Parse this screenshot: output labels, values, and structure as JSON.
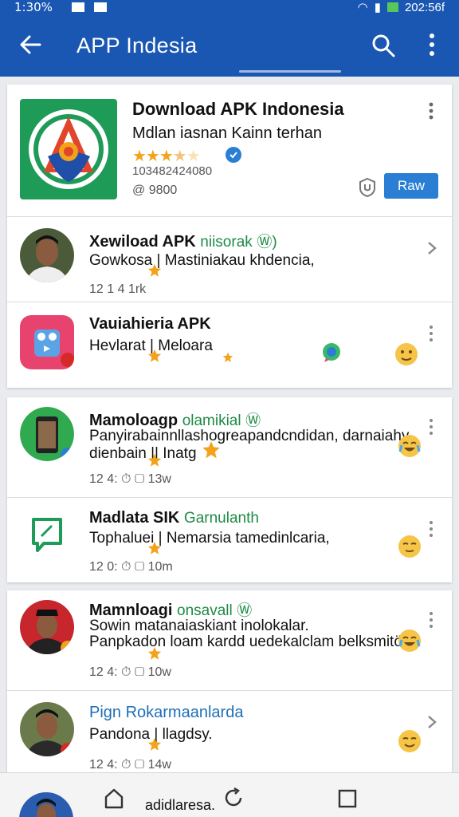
{
  "status_bar": {
    "time": "1:30%",
    "right_text": "202:56f"
  },
  "app_bar": {
    "title": "APP Indesia"
  },
  "featured": {
    "title": "Download APK Indonesia",
    "subtitle": "Mdlan iasnan Kainn terhan",
    "rating_stars": 3.5,
    "meta1": "103482424080",
    "meta2": "@ 9800",
    "action_label": "Raw"
  },
  "list1": [
    {
      "name": "Xewiload APK",
      "tag": "niisorak",
      "desc": "Gowkosa | Mastiniakau khdencia,",
      "meta": "12 1  4  1rk"
    },
    {
      "name": "Vauiahieria APK",
      "tag": "",
      "desc": "Hevlarat | Meloara",
      "meta": ""
    }
  ],
  "list2": [
    {
      "name": "Mamoloagp",
      "tag": "olamikial",
      "desc": "Panyirabainnllashogreapandcndidan, darnaiahy",
      "desc2": "dienbain || Inatg",
      "meta": "12 4:  ⏱  ▢  13w"
    },
    {
      "name": "Madlata SIK",
      "tag": "Garnulanth",
      "desc": "Tophaluei | Nemarsia tamedinlcaria,",
      "meta": "12 0:  ⏱  ▢  10m"
    }
  ],
  "list3": [
    {
      "name": "Mamnloagi",
      "tag": "onsavall",
      "desc": "Sowin matanaiaskiant inolokalar.",
      "desc2": "Panpkadon loam kardd uedekalclam belksmitö",
      "meta": "12 4:  ⏱  ▢  10w"
    },
    {
      "name": "Pign Rokarmaanlarda",
      "tag": "",
      "desc": "Pandona | llagdsy.",
      "meta": "12 4:  ⏱  ▢  14w"
    }
  ],
  "bottom_nav": {
    "label": "adidlaresa."
  },
  "colors": {
    "primary": "#1a57b2",
    "accent": "#2a7fd4",
    "star": "#f2a31b"
  }
}
